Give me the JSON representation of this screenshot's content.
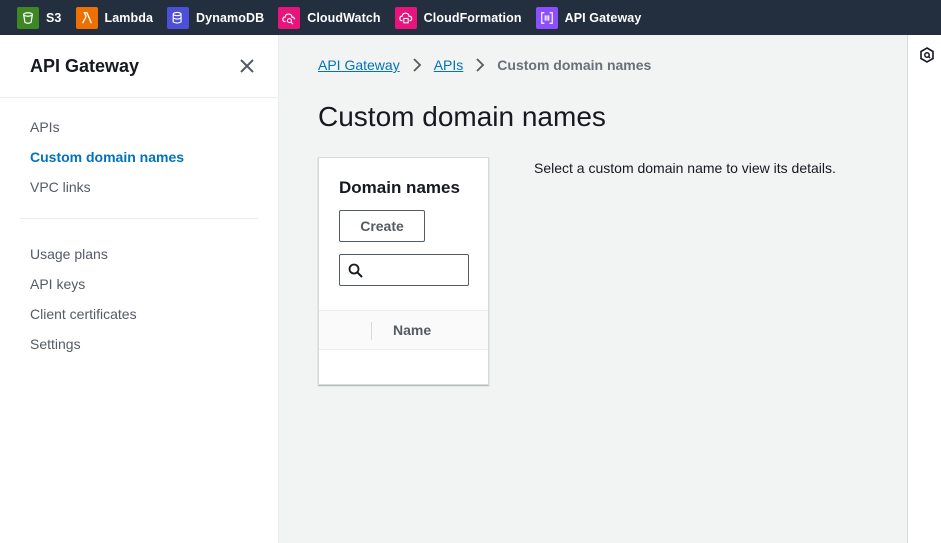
{
  "favorites": [
    {
      "label": "S3",
      "color": "#3f8624",
      "icon": "bucket-icon"
    },
    {
      "label": "Lambda",
      "color": "#ed7100",
      "icon": "lambda-icon"
    },
    {
      "label": "DynamoDB",
      "color": "#4d4fd6",
      "icon": "database-icon"
    },
    {
      "label": "CloudWatch",
      "color": "#e7157b",
      "icon": "cloud-search-icon"
    },
    {
      "label": "CloudFormation",
      "color": "#e7157b",
      "icon": "stack-cloud-icon"
    },
    {
      "label": "API Gateway",
      "color": "#8c4fff",
      "icon": "api-brackets-icon"
    }
  ],
  "sidebar": {
    "title": "API Gateway",
    "group1": [
      "APIs",
      "Custom domain names",
      "VPC links"
    ],
    "group2": [
      "Usage plans",
      "API keys",
      "Client certificates",
      "Settings"
    ],
    "active": "Custom domain names"
  },
  "breadcrumb": {
    "items": [
      "API Gateway",
      "APIs"
    ],
    "current": "Custom domain names"
  },
  "page": {
    "title": "Custom domain names",
    "detail_message": "Select a custom domain name to view its details."
  },
  "panel": {
    "title": "Domain names",
    "create_label": "Create",
    "search_value": "",
    "column_name": "Name"
  },
  "colors": {
    "topbar": "#232f3e",
    "link": "#0073bb",
    "background": "#f2f3f3"
  }
}
